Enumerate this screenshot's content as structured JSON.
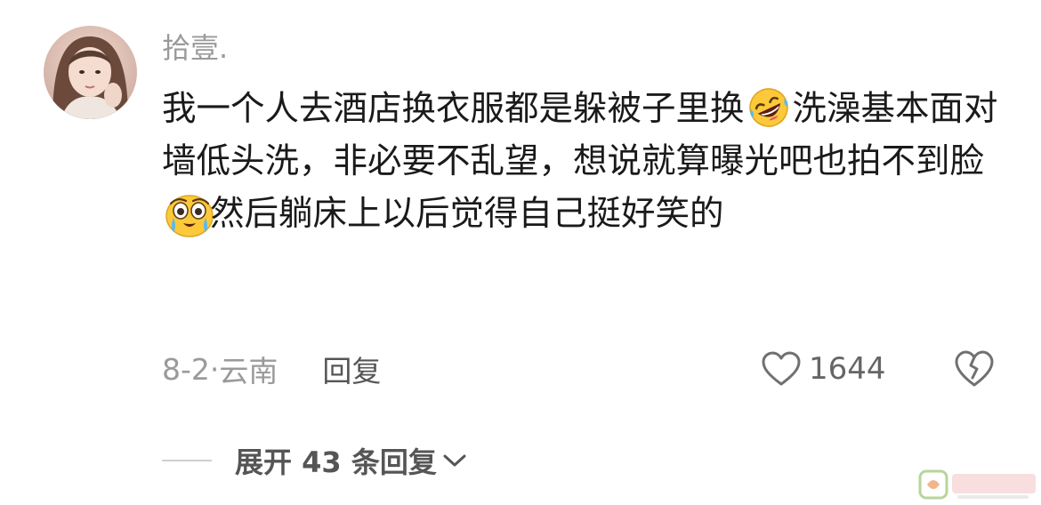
{
  "comment": {
    "username": "拾壹.",
    "segments": [
      "我一个人去酒店换衣服都是躲被子里换",
      "洗澡基本面对墙低头洗，非必要不乱望，想说就算曝光吧也拍不到脸",
      "然后躺床上以后觉得自己挺好笑的"
    ],
    "emojis": [
      "rofl-emoji-icon",
      "joy-tears-emoji-icon"
    ],
    "date": "8-2",
    "location": "云南",
    "reply_label": "回复",
    "like_count": "1644"
  },
  "replies": {
    "expand_label": "展开 43 条回复"
  },
  "colors": {
    "text": "#1a1a1a",
    "muted": "#9a9a9a",
    "action": "#555555"
  }
}
